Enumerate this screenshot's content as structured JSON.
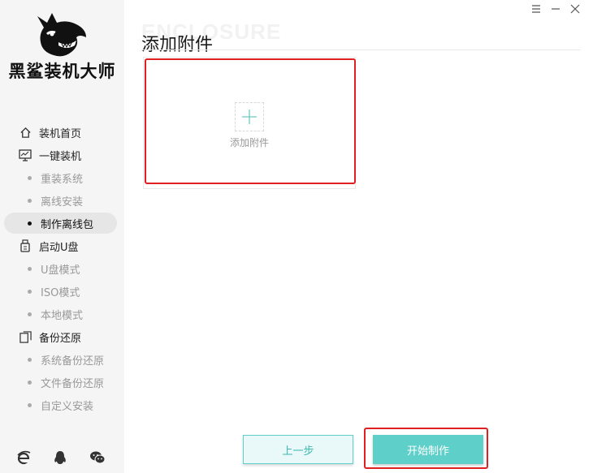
{
  "app": {
    "name": "黑鲨装机大师",
    "watermark": "ENCLOSURE"
  },
  "sidebar": {
    "items": [
      {
        "label": "装机首页",
        "icon": "home-icon",
        "type": "parent"
      },
      {
        "label": "一键装机",
        "icon": "monitor-icon",
        "type": "parent"
      },
      {
        "label": "重装系统",
        "type": "child"
      },
      {
        "label": "离线安装",
        "type": "child"
      },
      {
        "label": "制作离线包",
        "type": "child",
        "active": true
      },
      {
        "label": "启动U盘",
        "icon": "usb-icon",
        "type": "parent"
      },
      {
        "label": "U盘模式",
        "type": "child"
      },
      {
        "label": "ISO模式",
        "type": "child"
      },
      {
        "label": "本地模式",
        "type": "child"
      },
      {
        "label": "备份还原",
        "icon": "backup-icon",
        "type": "parent"
      },
      {
        "label": "系统备份还原",
        "type": "child"
      },
      {
        "label": "文件备份还原",
        "type": "child"
      },
      {
        "label": "自定义安装",
        "type": "child"
      }
    ],
    "bottom_icons": [
      "ie-browser-icon",
      "qq-icon",
      "wechat-icon"
    ]
  },
  "main": {
    "title": "添加附件",
    "upload_label": "添加附件"
  },
  "footer": {
    "prev_label": "上一步",
    "start_label": "开始制作"
  },
  "colors": {
    "accent": "#5fcfc9",
    "highlight": "#e02020",
    "sidebar_bg": "#f5f5f5"
  }
}
